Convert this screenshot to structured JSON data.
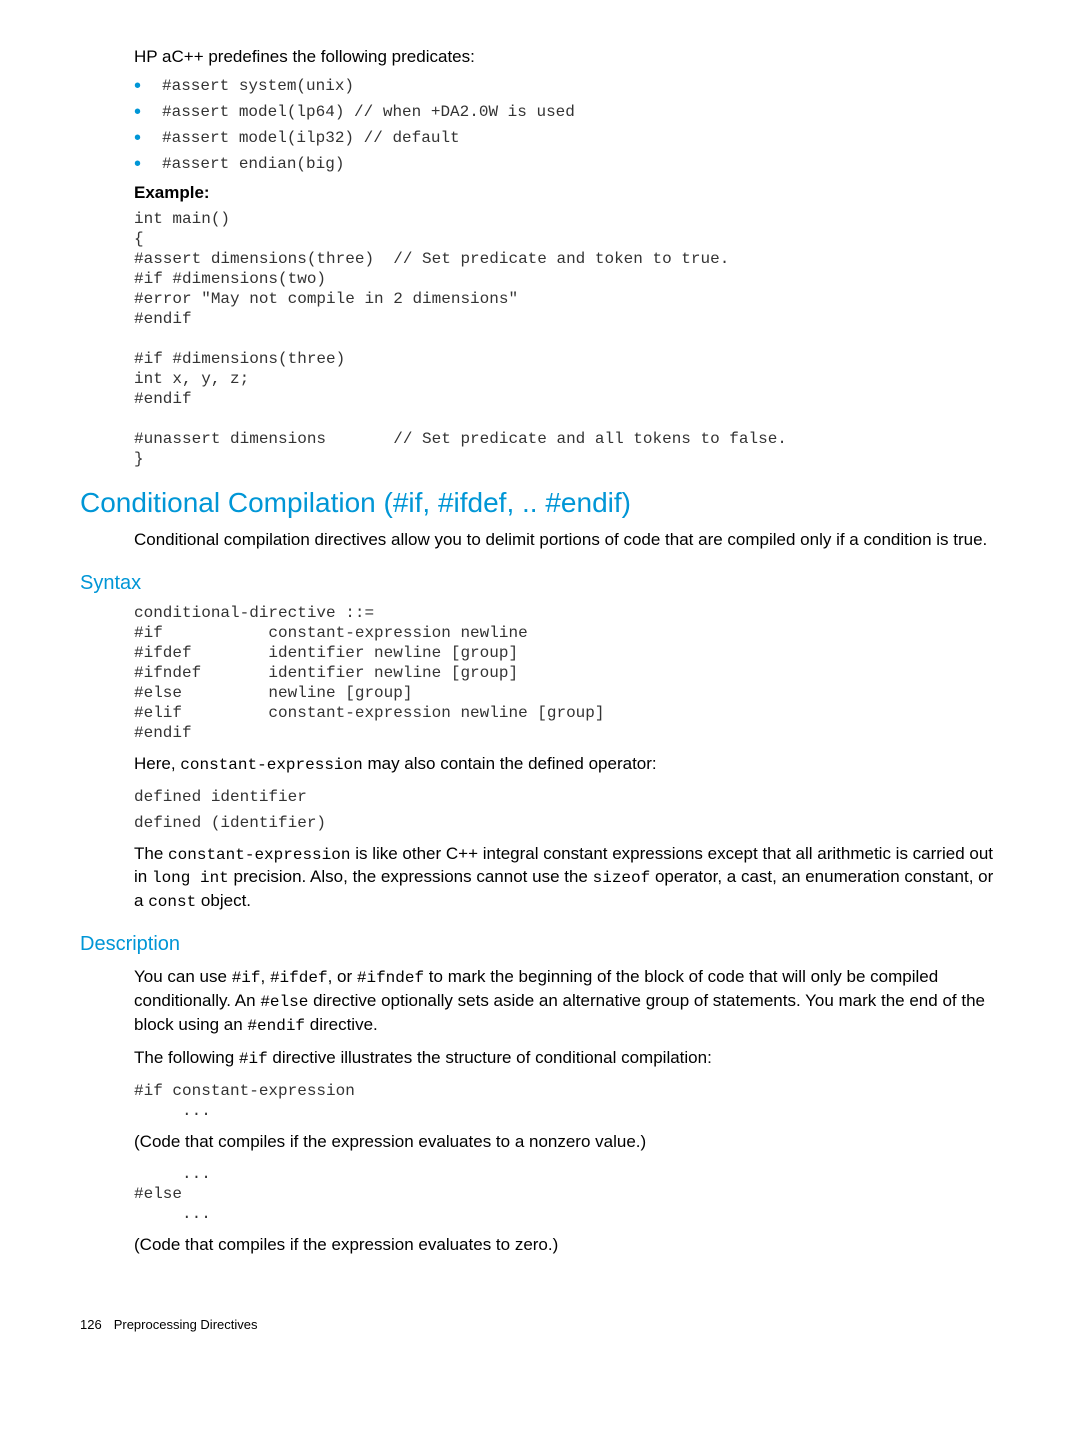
{
  "intro": "HP aC++ predefines the following predicates:",
  "predefines": [
    "#assert system(unix)",
    "#assert model(lp64) // when +DA2.0W is used",
    "#assert model(ilp32) // default",
    "#assert endian(big)"
  ],
  "example_label": "Example:",
  "example_code": "int main()\n{\n#assert dimensions(three)  // Set predicate and token to true.\n#if #dimensions(two)\n#error \"May not compile in 2 dimensions\"\n#endif\n\n#if #dimensions(three)\nint x, y, z;\n#endif\n\n#unassert dimensions       // Set predicate and all tokens to false.\n}",
  "section_title": "Conditional Compilation (#if, #ifdef, .. #endif)",
  "section_intro": "Conditional compilation directives allow you to delimit portions of code that are compiled only if a condition is true.",
  "syntax_title": "Syntax",
  "syntax_block": "conditional-directive ::=\n#if           constant-expression newline\n#ifdef        identifier newline [group]\n#ifndef       identifier newline [group]\n#else         newline [group]\n#elif         constant-expression newline [group]\n#endif",
  "syntax_after_pref": "Here, ",
  "syntax_after_code": "constant-expression",
  "syntax_after_suf": " may also contain the defined operator:",
  "defined1": "defined identifier",
  "defined2": "defined (identifier)",
  "const_para": {
    "p1": "The ",
    "c1": "constant-expression",
    "p2": " is like other C++ integral constant expressions except that all arithmetic is carried out in ",
    "c2": "long int",
    "p3": " precision. Also, the expressions cannot use the ",
    "c3": "sizeof",
    "p4": " operator, a cast, an enumeration constant, or a ",
    "c4": "const",
    "p5": " object."
  },
  "description_title": "Description",
  "desc_para1": {
    "p1": "You can use ",
    "c1": "#if",
    "p1b": ", ",
    "c2": "#ifdef",
    "p1c": ", or ",
    "c3": "#ifndef",
    "p2": " to mark the beginning of the block of code that will only be compiled conditionally. An ",
    "c4": "#else",
    "p3": " directive optionally sets aside an alternative group of statements. You mark the end of the block using an ",
    "c5": "#endif",
    "p4": " directive."
  },
  "desc_para2": {
    "p1": "The following ",
    "c1": "#if",
    "p2": " directive illustrates the structure of conditional compilation:"
  },
  "if_block": "#if constant-expression\n     ...",
  "paren1": "(Code that compiles if the expression evaluates to a nonzero value.)",
  "else_block": "     ...\n#else\n     ...",
  "paren2": "(Code that compiles if the expression evaluates to zero.)",
  "footer_page": "126",
  "footer_text": "Preprocessing Directives"
}
